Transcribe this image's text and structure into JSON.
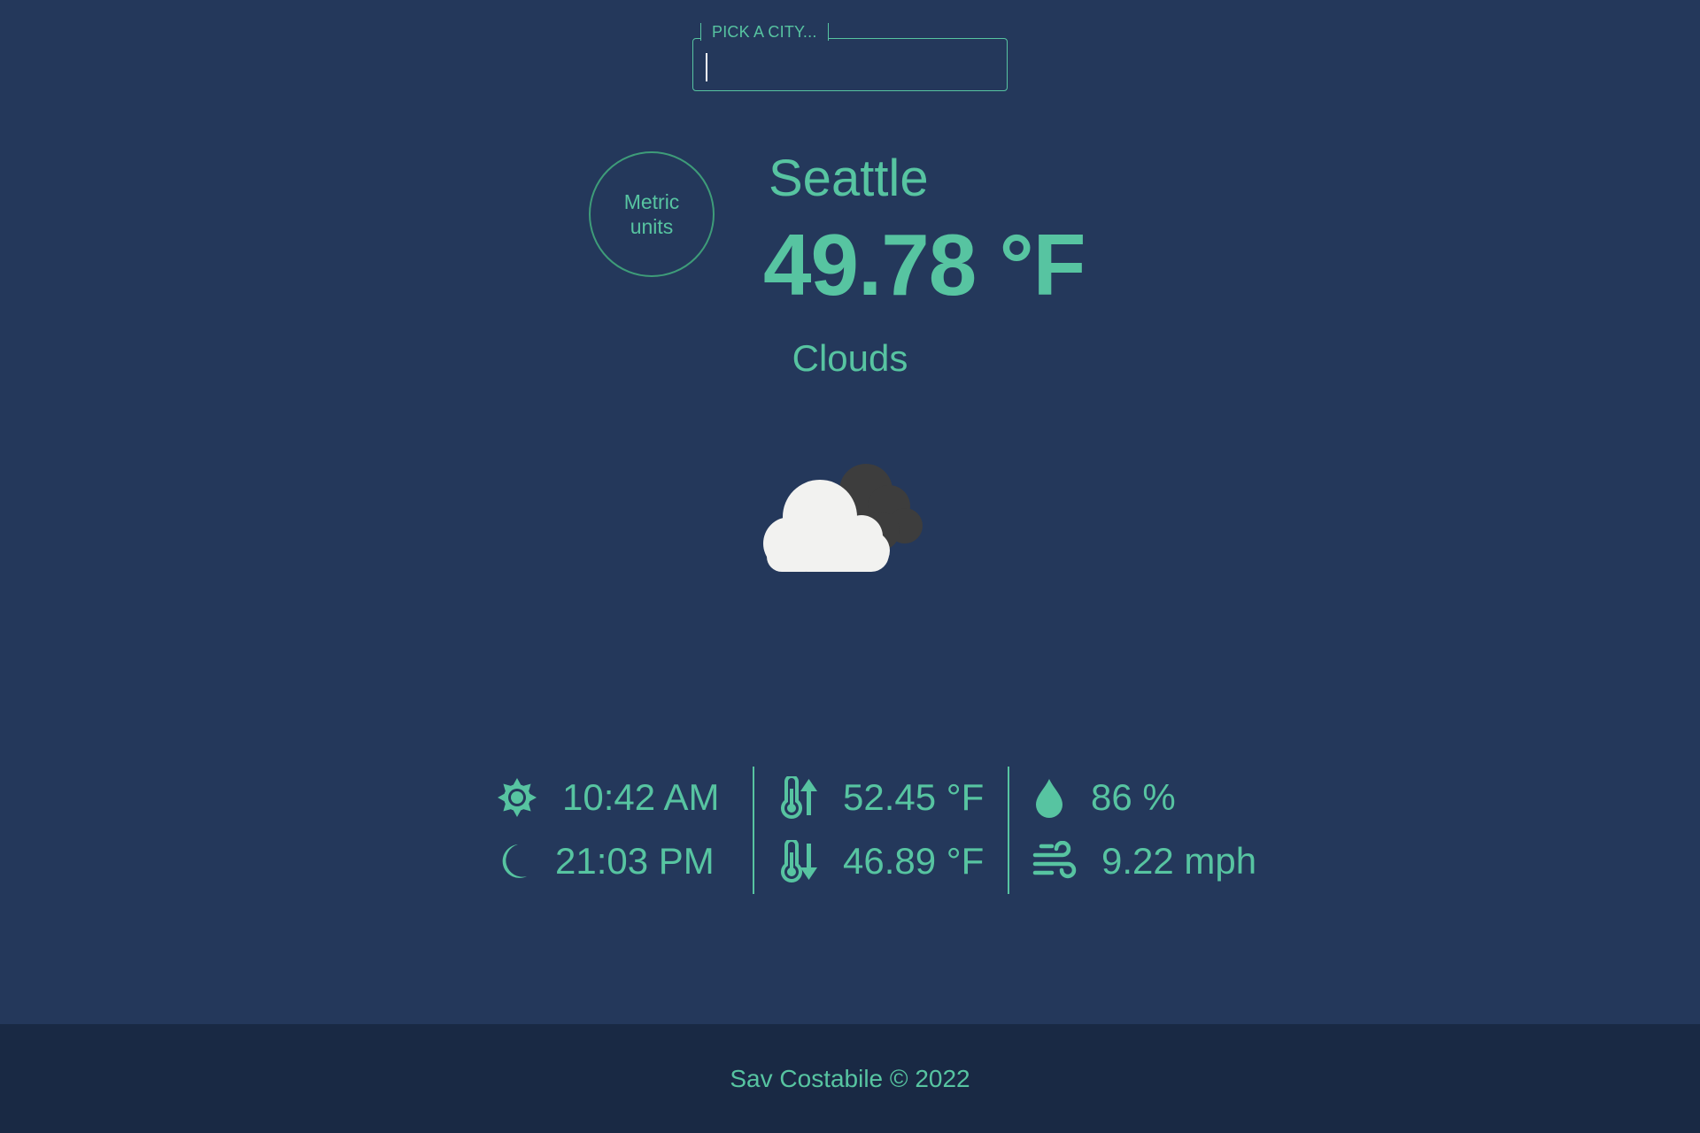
{
  "search": {
    "legend": "PICK A CITY...",
    "value": "",
    "placeholder": ""
  },
  "unit_toggle": {
    "line1": "Metric",
    "line2": "units"
  },
  "weather": {
    "city": "Seattle",
    "temperature": "49.78 °F",
    "condition": "Clouds",
    "icon": "cloud-icon"
  },
  "stats": {
    "sunrise": {
      "icon": "sun-icon",
      "value": "10:42 AM"
    },
    "sunset": {
      "icon": "moon-icon",
      "value": "21:03 PM"
    },
    "temp_max": {
      "icon": "thermometer-up-icon",
      "value": "52.45 °F"
    },
    "temp_min": {
      "icon": "thermometer-down-icon",
      "value": "46.89 °F"
    },
    "humidity": {
      "icon": "droplet-icon",
      "value": "86 %"
    },
    "wind": {
      "icon": "wind-icon",
      "value": "9.22 mph"
    }
  },
  "footer": {
    "text": "Sav Costabile © 2022"
  },
  "colors": {
    "background": "#24385b",
    "footer_background": "#192944",
    "accent": "#57c4a1"
  }
}
